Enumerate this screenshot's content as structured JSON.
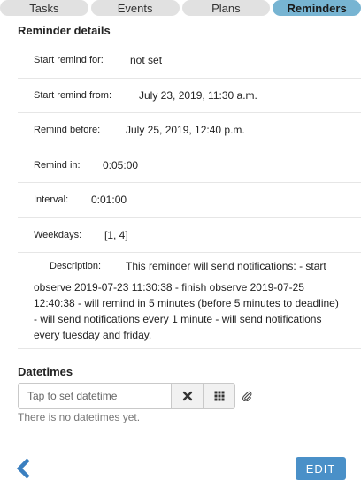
{
  "tabs": [
    {
      "label": "Tasks",
      "active": false
    },
    {
      "label": "Events",
      "active": false
    },
    {
      "label": "Plans",
      "active": false
    },
    {
      "label": "Reminders",
      "active": true
    }
  ],
  "reminder": {
    "title": "Reminder details",
    "start_remind_for": {
      "label": "Start remind for:",
      "value": "not set"
    },
    "start_remind_from": {
      "label": "Start remind from:",
      "value": "July 23, 2019, 11:30 a.m."
    },
    "remind_before": {
      "label": "Remind before:",
      "value": "July 25, 2019, 12:40 p.m."
    },
    "remind_in": {
      "label": "Remind in:",
      "value": "0:05:00"
    },
    "interval": {
      "label": "Interval:",
      "value": "0:01:00"
    },
    "weekdays": {
      "label": "Weekdays:",
      "value": "[1, 4]"
    },
    "description": {
      "label": "Description:",
      "value_first": "This reminder will send notifications: - start",
      "value_rest": "observe 2019-07-23 11:30:38 - finish observe 2019-07-25 12:40:38 - will remind in 5 minutes (before 5 minutes to deadline) - will send notifications every 1 minute - will send notifications every tuesday and friday."
    }
  },
  "datetimes": {
    "title": "Datetimes",
    "placeholder": "Tap to set datetime",
    "empty_text": "There is no datetimes yet."
  },
  "footer": {
    "edit_label": "EDIT"
  },
  "colors": {
    "active_tab": "#77b4d2",
    "accent": "#4a90c8"
  },
  "icons": [
    "clear-icon",
    "calendar-grid-icon",
    "paperclip-icon",
    "back-chevron-icon"
  ]
}
